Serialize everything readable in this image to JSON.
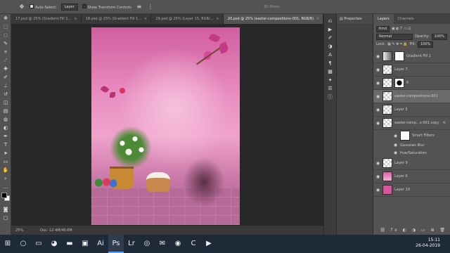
{
  "options_bar": {
    "move_icon": "move-tool-icon",
    "auto_select_label": "Auto-Select:",
    "auto_select_value": "Layer",
    "show_transform_label": "Show Transform Controls",
    "mode_3d_label": "3D Mode:"
  },
  "tabs": [
    {
      "label": "17.psd @ 25% (Gradient Fill 1...",
      "active": false
    },
    {
      "label": "18.psd @ 25% (Gradient Fill 1...",
      "active": false
    },
    {
      "label": "19.psd @ 25% (Layer 15, RGB/...",
      "active": false
    },
    {
      "label": "20.psd @ 25% (easter-compositions-001, RGB/8)",
      "active": true
    }
  ],
  "status": {
    "zoom": "25%",
    "doc": "Doc: 12.4M/46.6M"
  },
  "properties_panel": {
    "title": "Properties"
  },
  "layers_panel": {
    "tab_layers": "Layers",
    "tab_channels": "Channels",
    "filter_kind": "Kind",
    "blend_mode": "Normal",
    "opacity_label": "Opacity:",
    "opacity_value": "100%",
    "lock_label": "Lock:",
    "fill_label": "Fill:",
    "fill_value": "100%",
    "layers": [
      {
        "name": "Gradient Fill 1"
      },
      {
        "name": "Layer 7"
      },
      {
        "name": "6"
      },
      {
        "name": "easter-compositions-001"
      },
      {
        "name": "Layer 5"
      },
      {
        "name": "easter-comp...s-001 copy"
      },
      {
        "name": "Smart Filters"
      },
      {
        "name": "Gaussian Blur"
      },
      {
        "name": "Hue/Saturation"
      },
      {
        "name": "Layer 9"
      },
      {
        "name": "Layer 0"
      },
      {
        "name": "Layer 10"
      }
    ]
  },
  "taskbar": {
    "time": "15:11",
    "date": "26-04-2019"
  }
}
